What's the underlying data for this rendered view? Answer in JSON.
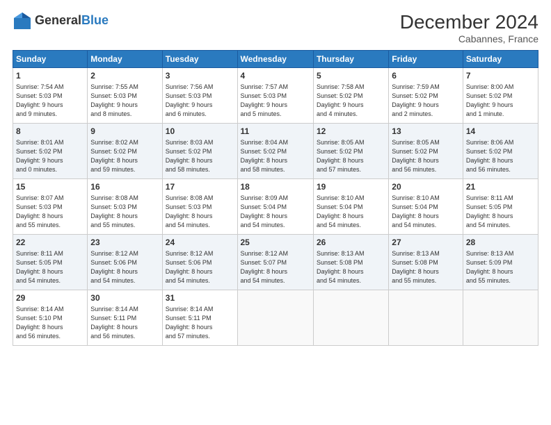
{
  "header": {
    "logo_general": "General",
    "logo_blue": "Blue",
    "month_title": "December 2024",
    "location": "Cabannes, France"
  },
  "days_of_week": [
    "Sunday",
    "Monday",
    "Tuesday",
    "Wednesday",
    "Thursday",
    "Friday",
    "Saturday"
  ],
  "weeks": [
    [
      {
        "day": "1",
        "info": "Sunrise: 7:54 AM\nSunset: 5:03 PM\nDaylight: 9 hours\nand 9 minutes."
      },
      {
        "day": "2",
        "info": "Sunrise: 7:55 AM\nSunset: 5:03 PM\nDaylight: 9 hours\nand 8 minutes."
      },
      {
        "day": "3",
        "info": "Sunrise: 7:56 AM\nSunset: 5:03 PM\nDaylight: 9 hours\nand 6 minutes."
      },
      {
        "day": "4",
        "info": "Sunrise: 7:57 AM\nSunset: 5:03 PM\nDaylight: 9 hours\nand 5 minutes."
      },
      {
        "day": "5",
        "info": "Sunrise: 7:58 AM\nSunset: 5:02 PM\nDaylight: 9 hours\nand 4 minutes."
      },
      {
        "day": "6",
        "info": "Sunrise: 7:59 AM\nSunset: 5:02 PM\nDaylight: 9 hours\nand 2 minutes."
      },
      {
        "day": "7",
        "info": "Sunrise: 8:00 AM\nSunset: 5:02 PM\nDaylight: 9 hours\nand 1 minute."
      }
    ],
    [
      {
        "day": "8",
        "info": "Sunrise: 8:01 AM\nSunset: 5:02 PM\nDaylight: 9 hours\nand 0 minutes."
      },
      {
        "day": "9",
        "info": "Sunrise: 8:02 AM\nSunset: 5:02 PM\nDaylight: 8 hours\nand 59 minutes."
      },
      {
        "day": "10",
        "info": "Sunrise: 8:03 AM\nSunset: 5:02 PM\nDaylight: 8 hours\nand 58 minutes."
      },
      {
        "day": "11",
        "info": "Sunrise: 8:04 AM\nSunset: 5:02 PM\nDaylight: 8 hours\nand 58 minutes."
      },
      {
        "day": "12",
        "info": "Sunrise: 8:05 AM\nSunset: 5:02 PM\nDaylight: 8 hours\nand 57 minutes."
      },
      {
        "day": "13",
        "info": "Sunrise: 8:05 AM\nSunset: 5:02 PM\nDaylight: 8 hours\nand 56 minutes."
      },
      {
        "day": "14",
        "info": "Sunrise: 8:06 AM\nSunset: 5:02 PM\nDaylight: 8 hours\nand 56 minutes."
      }
    ],
    [
      {
        "day": "15",
        "info": "Sunrise: 8:07 AM\nSunset: 5:03 PM\nDaylight: 8 hours\nand 55 minutes."
      },
      {
        "day": "16",
        "info": "Sunrise: 8:08 AM\nSunset: 5:03 PM\nDaylight: 8 hours\nand 55 minutes."
      },
      {
        "day": "17",
        "info": "Sunrise: 8:08 AM\nSunset: 5:03 PM\nDaylight: 8 hours\nand 54 minutes."
      },
      {
        "day": "18",
        "info": "Sunrise: 8:09 AM\nSunset: 5:04 PM\nDaylight: 8 hours\nand 54 minutes."
      },
      {
        "day": "19",
        "info": "Sunrise: 8:10 AM\nSunset: 5:04 PM\nDaylight: 8 hours\nand 54 minutes."
      },
      {
        "day": "20",
        "info": "Sunrise: 8:10 AM\nSunset: 5:04 PM\nDaylight: 8 hours\nand 54 minutes."
      },
      {
        "day": "21",
        "info": "Sunrise: 8:11 AM\nSunset: 5:05 PM\nDaylight: 8 hours\nand 54 minutes."
      }
    ],
    [
      {
        "day": "22",
        "info": "Sunrise: 8:11 AM\nSunset: 5:05 PM\nDaylight: 8 hours\nand 54 minutes."
      },
      {
        "day": "23",
        "info": "Sunrise: 8:12 AM\nSunset: 5:06 PM\nDaylight: 8 hours\nand 54 minutes."
      },
      {
        "day": "24",
        "info": "Sunrise: 8:12 AM\nSunset: 5:06 PM\nDaylight: 8 hours\nand 54 minutes."
      },
      {
        "day": "25",
        "info": "Sunrise: 8:12 AM\nSunset: 5:07 PM\nDaylight: 8 hours\nand 54 minutes."
      },
      {
        "day": "26",
        "info": "Sunrise: 8:13 AM\nSunset: 5:08 PM\nDaylight: 8 hours\nand 54 minutes."
      },
      {
        "day": "27",
        "info": "Sunrise: 8:13 AM\nSunset: 5:08 PM\nDaylight: 8 hours\nand 55 minutes."
      },
      {
        "day": "28",
        "info": "Sunrise: 8:13 AM\nSunset: 5:09 PM\nDaylight: 8 hours\nand 55 minutes."
      }
    ],
    [
      {
        "day": "29",
        "info": "Sunrise: 8:14 AM\nSunset: 5:10 PM\nDaylight: 8 hours\nand 56 minutes."
      },
      {
        "day": "30",
        "info": "Sunrise: 8:14 AM\nSunset: 5:11 PM\nDaylight: 8 hours\nand 56 minutes."
      },
      {
        "day": "31",
        "info": "Sunrise: 8:14 AM\nSunset: 5:11 PM\nDaylight: 8 hours\nand 57 minutes."
      },
      {
        "day": "",
        "info": ""
      },
      {
        "day": "",
        "info": ""
      },
      {
        "day": "",
        "info": ""
      },
      {
        "day": "",
        "info": ""
      }
    ]
  ]
}
